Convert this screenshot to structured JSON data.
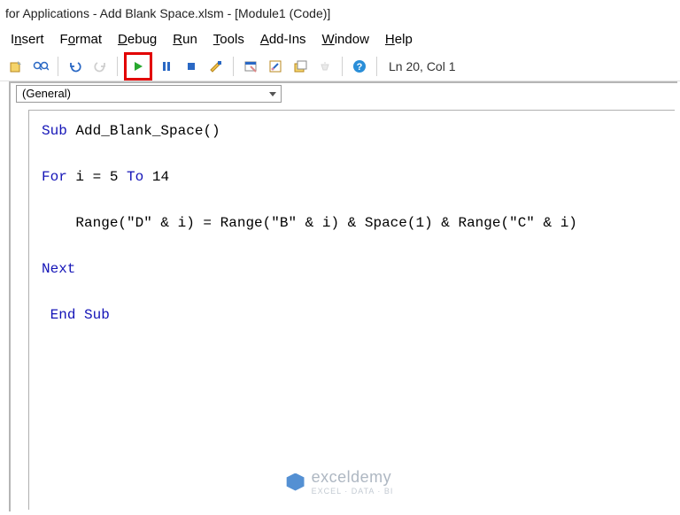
{
  "titlebar": "for Applications - Add Blank Space.xlsm - [Module1 (Code)]",
  "menus": {
    "insert": {
      "pre": "I",
      "u": "n",
      "post": "sert"
    },
    "format": {
      "pre": "F",
      "u": "o",
      "post": "rmat"
    },
    "debug": {
      "pre": "",
      "u": "D",
      "post": "ebug"
    },
    "run": {
      "pre": "",
      "u": "R",
      "post": "un"
    },
    "tools": {
      "pre": "",
      "u": "T",
      "post": "ools"
    },
    "addins": {
      "pre": "",
      "u": "A",
      "post": "dd-Ins"
    },
    "window": {
      "pre": "",
      "u": "W",
      "post": "indow"
    },
    "help": {
      "pre": "",
      "u": "H",
      "post": "elp"
    }
  },
  "toolbar": {
    "position_label": "Ln 20, Col 1"
  },
  "dropdown": {
    "general": "(General)"
  },
  "code": {
    "line1": {
      "kw": "Sub",
      "rest": " Add_Blank_Space()"
    },
    "line2": "",
    "line3": {
      "kw1": "For",
      "mid": " i = 5 ",
      "kw2": "To",
      "rest": " 14"
    },
    "line4": "",
    "line5": "    Range(\"D\" & i) = Range(\"B\" & i) & Space(1) & Range(\"C\" & i)",
    "line6": "",
    "line7": {
      "kw": "Next"
    },
    "line8": "",
    "line9": {
      "pre": " ",
      "kw": "End Sub"
    }
  },
  "watermark": {
    "brand": "exceldemy",
    "tag": "EXCEL · DATA · BI"
  }
}
